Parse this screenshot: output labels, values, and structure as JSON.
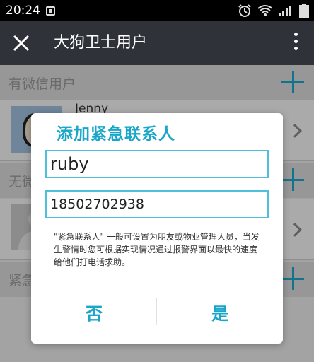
{
  "status_bar": {
    "time": "20:24"
  },
  "header": {
    "title": "大狗卫士用户"
  },
  "sections": {
    "with_wechat": "有微信用户",
    "without_wechat": "无微",
    "emergency": "紧急"
  },
  "contacts": {
    "first_name_partial": "Jenny"
  },
  "dialog": {
    "title": "添加紧急联系人",
    "name_value": "ruby",
    "phone_value": "18502702938",
    "hint": "\"紧急联系人\" 一般可设置为朋友或物业管理人员，当发生警情时您可根据实现情况通过报警界面以最快的速度给他们打电话求助。",
    "no_label": "否",
    "yes_label": "是"
  },
  "colors": {
    "accent": "#1aa6c9",
    "header_bg": "#2f3339"
  }
}
